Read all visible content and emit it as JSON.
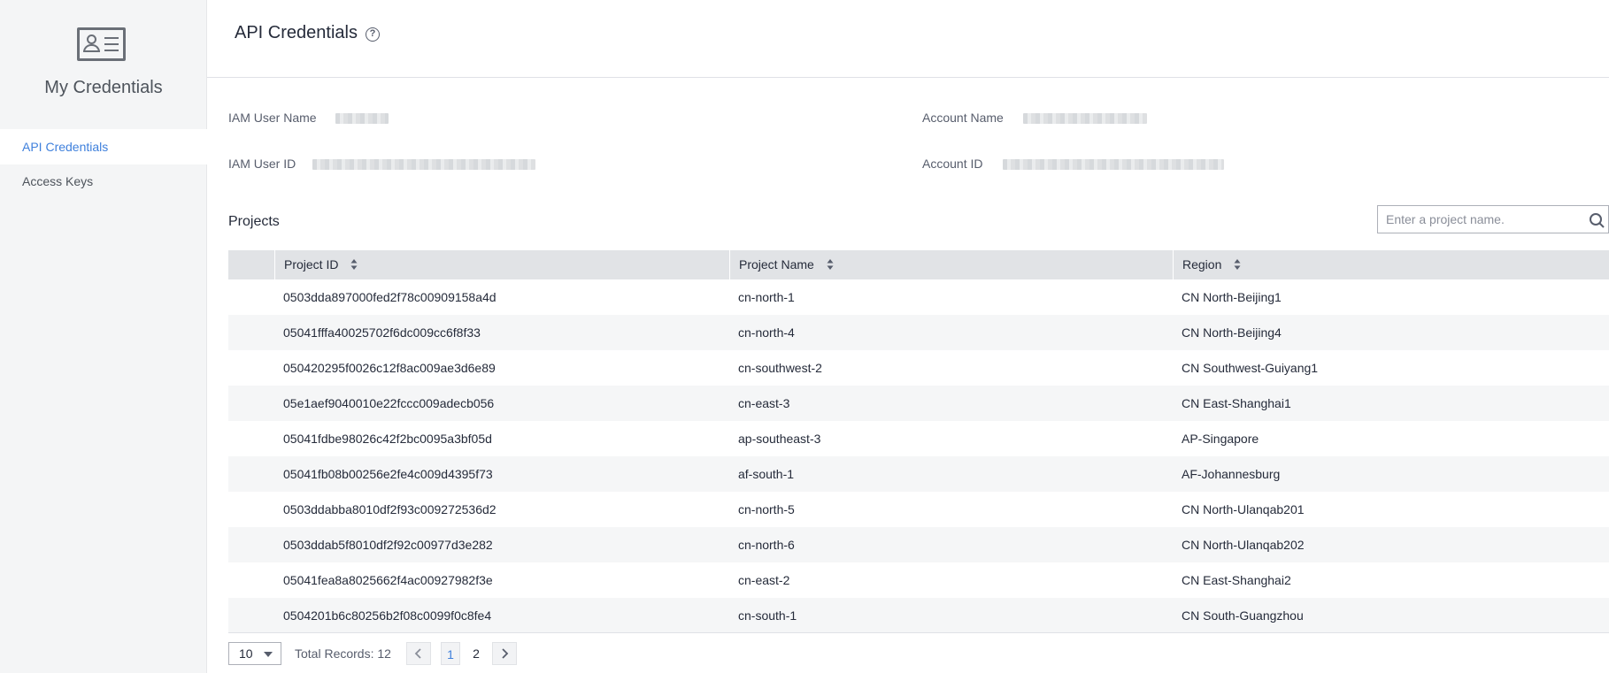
{
  "sidebar": {
    "title": "My Credentials",
    "items": [
      {
        "label": "API Credentials"
      },
      {
        "label": "Access Keys"
      }
    ]
  },
  "header": {
    "title": "API Credentials"
  },
  "info": {
    "iam_user_name_label": "IAM User Name",
    "iam_user_id_label": "IAM User ID",
    "account_name_label": "Account Name",
    "account_id_label": "Account ID"
  },
  "projects": {
    "title": "Projects",
    "search_placeholder": "Enter a project name.",
    "columns": [
      "Project ID",
      "Project Name",
      "Region"
    ],
    "rows": [
      [
        "0503dda897000fed2f78c00909158a4d",
        "cn-north-1",
        "CN North-Beijing1"
      ],
      [
        "05041fffa40025702f6dc009cc6f8f33",
        "cn-north-4",
        "CN North-Beijing4"
      ],
      [
        "050420295f0026c12f8ac009ae3d6e89",
        "cn-southwest-2",
        "CN Southwest-Guiyang1"
      ],
      [
        "05e1aef9040010e22fccc009adecb056",
        "cn-east-3",
        "CN East-Shanghai1"
      ],
      [
        "05041fdbe98026c42f2bc0095a3bf05d",
        "ap-southeast-3",
        "AP-Singapore"
      ],
      [
        "05041fb08b00256e2fe4c009d4395f73",
        "af-south-1",
        "AF-Johannesburg"
      ],
      [
        "0503ddabba8010df2f93c009272536d2",
        "cn-north-5",
        "CN North-Ulanqab201"
      ],
      [
        "0503ddab5f8010df2f92c00977d3e282",
        "cn-north-6",
        "CN North-Ulanqab202"
      ],
      [
        "05041fea8a8025662f4ac00927982f3e",
        "cn-east-2",
        "CN East-Shanghai2"
      ],
      [
        "0504201b6c80256b2f08c0099f0c8fe4",
        "cn-south-1",
        "CN South-Guangzhou"
      ]
    ]
  },
  "pagination": {
    "page_size": "10",
    "total_label": "Total Records: 12",
    "pages": [
      "1",
      "2"
    ],
    "current_page": "1"
  },
  "colors": {
    "accent": "#3f80dc",
    "sidebar_bg": "#f4f5f6",
    "header_bg": "#e1e3e6",
    "row_alt_bg": "#f5f6f7"
  }
}
